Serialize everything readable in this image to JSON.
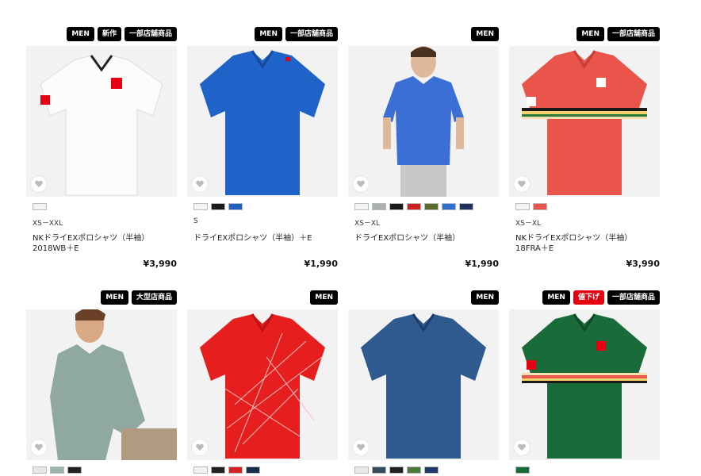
{
  "products": [
    {
      "badges": [
        {
          "label": "MEN",
          "color": "#000000"
        },
        {
          "label": "新作",
          "color": "#000000"
        },
        {
          "label": "一部店舗商品",
          "color": "#000000"
        }
      ],
      "image": "white-polo",
      "swatches": [
        "#f4f4f2"
      ],
      "size": "XS－XXL",
      "name": "NKドライEXポロシャツ（半袖）2018WB＋E",
      "price": "¥3,990"
    },
    {
      "badges": [
        {
          "label": "MEN",
          "color": "#000000"
        },
        {
          "label": "一部店舗商品",
          "color": "#000000"
        }
      ],
      "image": "blue-polo",
      "swatches": [
        "#f4f4f2",
        "#1a1a1a",
        "#1f5fc4"
      ],
      "size": "S",
      "name": "ドライEXポロシャツ（半袖）＋E",
      "price": "¥1,990"
    },
    {
      "badges": [
        {
          "label": "MEN",
          "color": "#000000"
        }
      ],
      "image": "model-blue-polo",
      "swatches": [
        "#f4f4f2",
        "#aab0b2",
        "#1a1a1a",
        "#cc2222",
        "#5a6b2a",
        "#2f6fd0",
        "#1f2e5a"
      ],
      "size": "XS－XL",
      "name": "ドライEXポロシャツ（半袖）",
      "price": "¥1,990"
    },
    {
      "badges": [
        {
          "label": "MEN",
          "color": "#000000"
        },
        {
          "label": "一部店舗商品",
          "color": "#000000"
        }
      ],
      "image": "coral-polo",
      "swatches": [
        "#f4f4f2",
        "#e9544b"
      ],
      "size": "XS－XL",
      "name": "NKドライEXポロシャツ（半袖）18FRA＋E",
      "price": "¥3,990"
    },
    {
      "badges": [
        {
          "label": "MEN",
          "color": "#000000"
        },
        {
          "label": "大型店商品",
          "color": "#000000"
        }
      ],
      "image": "model-mint-polo",
      "swatches": [
        "#e6e6e4",
        "#9cb3ad",
        "#222222"
      ],
      "size": "",
      "name": "",
      "price": ""
    },
    {
      "badges": [
        {
          "label": "MEN",
          "color": "#000000"
        }
      ],
      "image": "red-pattern-polo",
      "swatches": [
        "#f0f0f0",
        "#222222",
        "#d42020",
        "#1a2a4a"
      ],
      "size": "",
      "name": "",
      "price": ""
    },
    {
      "badges": [
        {
          "label": "MEN",
          "color": "#000000"
        }
      ],
      "image": "navy-pattern-polo",
      "swatches": [
        "#e8e8e8",
        "#3a4a5a",
        "#222222",
        "#4a7a3a",
        "#1f3a6a"
      ],
      "size": "",
      "name": "",
      "price": ""
    },
    {
      "badges": [
        {
          "label": "MEN",
          "color": "#000000"
        },
        {
          "label": "値下げ",
          "color": "#e60012"
        },
        {
          "label": "一部店舗商品",
          "color": "#000000"
        }
      ],
      "image": "green-polo",
      "swatches": [
        "#1a6b3a"
      ],
      "size": "",
      "name": "",
      "price": ""
    }
  ]
}
